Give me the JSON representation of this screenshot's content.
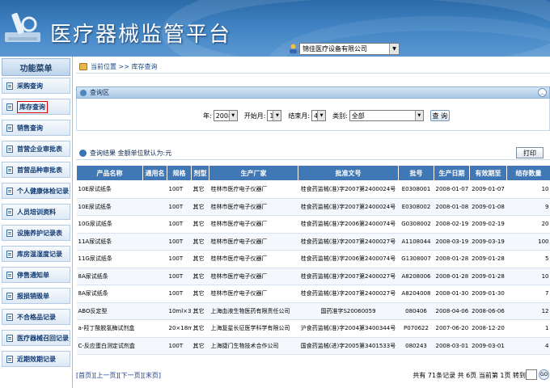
{
  "header": {
    "title": "医疗器械监管平台",
    "company": "锦佳医疗设备有限公司"
  },
  "sidebar": {
    "title": "功能菜单",
    "items": [
      {
        "label": "采购查询"
      },
      {
        "label": "库存查询"
      },
      {
        "label": "销售查询"
      },
      {
        "label": "首营企业审批表"
      },
      {
        "label": "首营品种审批表"
      },
      {
        "label": "个人健康体检记录"
      },
      {
        "label": "人员培训资料"
      },
      {
        "label": "设施养护记录表"
      },
      {
        "label": "库房温湿度记录"
      },
      {
        "label": "停售通知单"
      },
      {
        "label": "报损销毁单"
      },
      {
        "label": "不合格品记录"
      },
      {
        "label": "医疗器械召回记录"
      },
      {
        "label": "近期效期记录"
      }
    ]
  },
  "breadcrumb": {
    "text": "当前位置 >> 库存查询"
  },
  "query": {
    "section_title": "查询区",
    "year_label": "年:",
    "year_value": "2008",
    "start_month_label": "开始月:",
    "start_month_value": "1",
    "end_month_label": "结束月:",
    "end_month_value": "4",
    "category_label": "类别:",
    "category_value": "全部",
    "button": "查 询"
  },
  "results": {
    "title": "查询结果 金额单位默认为:元",
    "print_button": "打印",
    "columns": [
      "产品名称",
      "通用名",
      "规格",
      "剂型",
      "生产厂家",
      "批准文号",
      "批号",
      "生产日期",
      "有效期至",
      "结存数量"
    ],
    "rows": [
      [
        "10E尿试纸条",
        "",
        "100T",
        "其它",
        "桂林市医疗电子仪器厂",
        "桂食药监械(准)字2007第2400024号",
        "E0308001",
        "2008-01-07",
        "2009-01-07",
        "10"
      ],
      [
        "10E尿试纸条",
        "",
        "100T",
        "其它",
        "桂林市医疗电子仪器厂",
        "桂食药监械(准)字2007第2400024号",
        "E0308002",
        "2008-01-08",
        "2009-01-08",
        "9"
      ],
      [
        "10G尿试纸条",
        "",
        "100T",
        "其它",
        "桂林市医疗电子仪器厂",
        "桂食药监械(准)字2006第2400074号",
        "G0308002",
        "2008-02-19",
        "2009-02-19",
        "20"
      ],
      [
        "11A尿试纸条",
        "",
        "100T",
        "其它",
        "桂林市医疗电子仪器厂",
        "桂食药监械(准)字2007第2400027号",
        "A1108044",
        "2008-03-19",
        "2009-03-19",
        "100"
      ],
      [
        "11G尿试纸条",
        "",
        "100T",
        "其它",
        "桂林市医疗电子仪器厂",
        "桂食药监械(准)字2006第2400074号",
        "G1308007",
        "2008-01-28",
        "2009-01-28",
        "5"
      ],
      [
        "8A尿试纸条",
        "",
        "100T",
        "其它",
        "桂林市医疗电子仪器厂",
        "桂食药监械(准)字2007第2400027号",
        "A8208006",
        "2008-01-28",
        "2009-01-28",
        "10"
      ],
      [
        "8A尿试纸条",
        "",
        "100T",
        "其它",
        "桂林市医疗电子仪器厂",
        "桂食药监械(准)字2007第2400027号",
        "A8204008",
        "2008-01-30",
        "2009-01-30",
        "7"
      ],
      [
        "ABO反定型",
        "",
        "10ml×3",
        "其它",
        "上海血液生物医药有限责任公司",
        "国药准字S20060059",
        "080406",
        "2008-04-06",
        "2008-06-06",
        "12"
      ],
      [
        "a-羟丁酸脱氢酶试剂盒",
        "",
        "20×18ml",
        "其它",
        "上海复星长征医学科学有限公司",
        "沪食药监械(准)字2004第3400344号",
        "P070622",
        "2007-06-20",
        "2008-12-20",
        "1"
      ],
      [
        "C-反应蛋白测定试剂盒",
        "",
        "100T",
        "其它",
        "上海捷门生物技术合作公司",
        "国食药监械(进)字2005第3401533号",
        "080243",
        "2008-03-01",
        "2009-03-01",
        "4"
      ]
    ]
  },
  "pagination": {
    "first": "[首页]",
    "prev": "[上一页]",
    "next": "[下一页]",
    "last": "[末页]",
    "info": "共有 71条记录 共 6页 当前第 1页 转到",
    "page_unit": "页",
    "go": "GO"
  },
  "colors": {
    "header_blue": "#3f82c2",
    "table_header": "#3f78b5",
    "link": "#1a3f94"
  }
}
